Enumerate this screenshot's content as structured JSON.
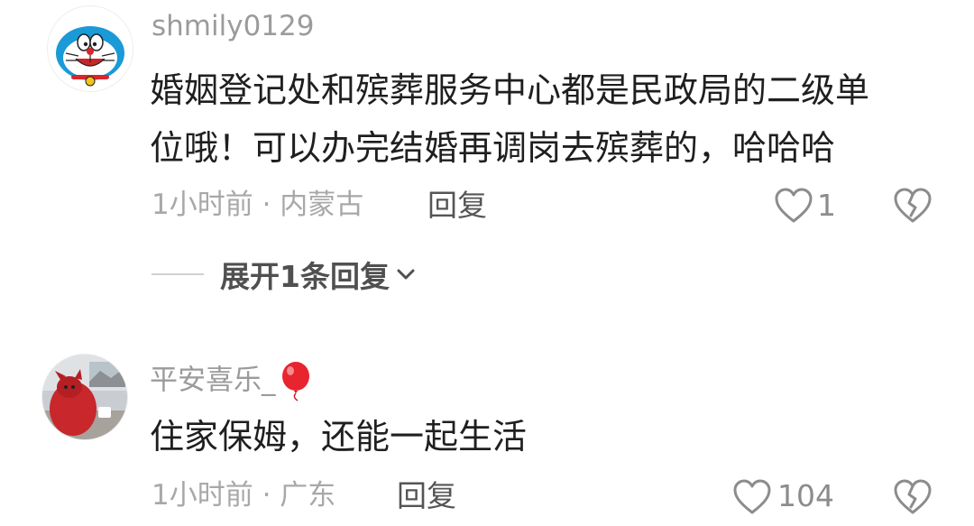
{
  "comments": [
    {
      "username": "shmily0129",
      "avatar": "doraemon-avatar",
      "text_lines": [
        "婚姻登记处和殡葬服务中心都是民政局的二级单",
        "位哦！可以办完结婚再调岗去殡葬的，哈哈哈"
      ],
      "meta": "1小时前 · 内蒙古",
      "reply_label": "回复",
      "likes": "1",
      "expand_replies": "展开1条回复"
    },
    {
      "username": "平安喜乐_",
      "username_emoji": "balloon-icon",
      "avatar": "red-mascot-photo-avatar",
      "text_lines": [
        "住家保姆，还能一起生活"
      ],
      "meta": "1小时前 · 广东",
      "reply_label": "回复",
      "likes": "104"
    }
  ],
  "colors": {
    "username": "#9b9b9b",
    "text": "#1f1f1f",
    "meta": "#a8a8a8",
    "icon": "#8c8c8c",
    "balloon": "#e8242f"
  }
}
